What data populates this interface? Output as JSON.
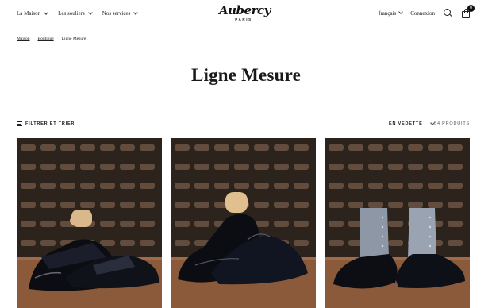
{
  "header": {
    "nav": [
      {
        "label": "La Maison"
      },
      {
        "label": "Les souliers"
      },
      {
        "label": "Nos services"
      }
    ],
    "logo": {
      "script": "Aubercy",
      "sub": "PARIS"
    },
    "language": "français",
    "login": "Connexion",
    "cart_count": "0"
  },
  "breadcrumb": [
    "Maison",
    "Boutique",
    "Ligne Mesure"
  ],
  "page_title": "Ligne Mesure",
  "toolbar": {
    "filter_label": "Filtrer et trier",
    "sort_label": "En vedette",
    "product_count": "54 produits"
  },
  "colors": {
    "text": "#1a1a1a",
    "shelf": "#5a4636",
    "leather": "#0d0f14"
  },
  "products": [
    {
      "image": "patent-leather-loafer-photo"
    },
    {
      "image": "black-derby-shoe-photo"
    },
    {
      "image": "black-and-grey-button-boot-photo"
    }
  ]
}
